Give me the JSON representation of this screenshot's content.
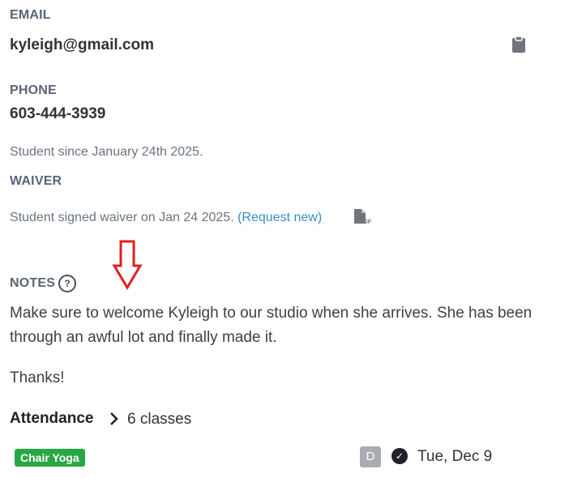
{
  "email": {
    "label": "EMAIL",
    "value": "kyleigh@gmail.com",
    "copy_icon": "clipboard-icon"
  },
  "phone": {
    "label": "PHONE",
    "value": "603-444-3939"
  },
  "student_since": "Student since January 24th 2025.",
  "waiver": {
    "label": "WAIVER",
    "text": "Student signed waiver on Jan 24 2025.",
    "request_link": "(Request new)",
    "pdf_icon_text": "PDF"
  },
  "notes": {
    "label": "NOTES",
    "help_icon_text": "?",
    "body": "Make sure to welcome Kyleigh to our studio when she arrives. She has been through an awful lot and finally made it.",
    "signoff": "Thanks!"
  },
  "attendance": {
    "label": "Attendance",
    "count": "6 classes",
    "rows": [
      {
        "class_name": "Chair Yoga",
        "avatar_initial": "D",
        "date": "Tue, Dec 9"
      }
    ]
  },
  "colors": {
    "badge": "#28a745",
    "link": "#3b8cc4",
    "arrow": "#e0201f"
  }
}
